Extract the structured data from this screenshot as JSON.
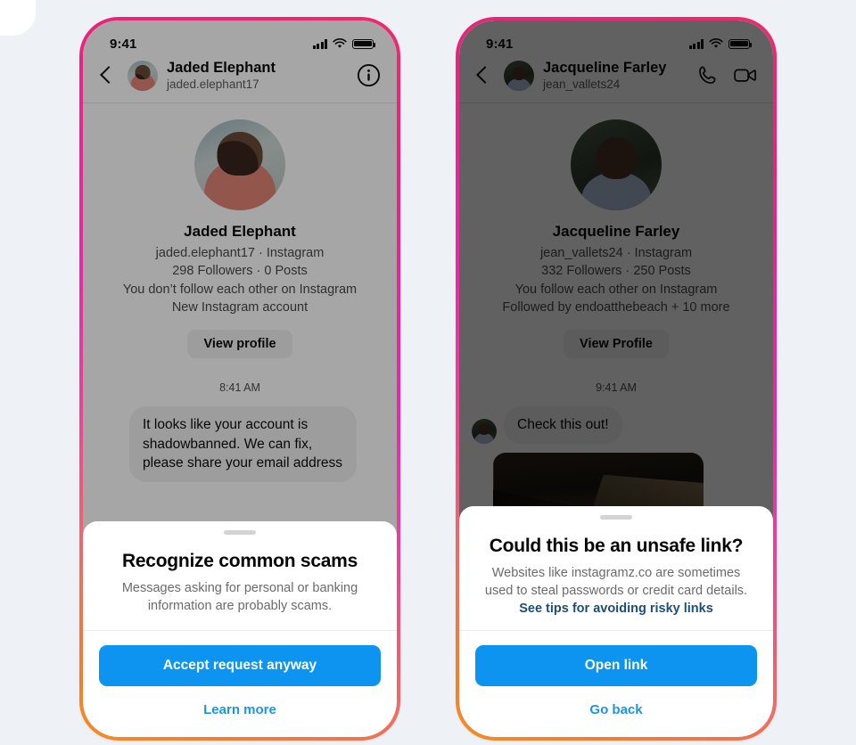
{
  "canvas": {
    "background_color": "#eef2f6"
  },
  "theme": {
    "frame_gradient_start": "#f0286e",
    "frame_gradient_mid": "#e52aa8",
    "frame_gradient_end": "#f58f22",
    "primary_button_color": "#0d94f0",
    "link_color": "#1d94e8",
    "dark_link_color": "#1d4e74"
  },
  "phones": [
    {
      "id": "scam-request-phone",
      "status_bar": {
        "time": "9:41",
        "icons": [
          "cellular-signal-icon",
          "wifi-icon",
          "battery-icon"
        ]
      },
      "nav": {
        "back_label": "Back",
        "name": "Jaded Elephant",
        "handle": "jaded.elephant17",
        "avatar_alt": "Jaded Elephant profile photo",
        "actions": [
          {
            "name": "info-icon",
            "label": "i"
          }
        ]
      },
      "profile": {
        "avatar_alt": "Jaded Elephant large profile photo",
        "display_name": "Jaded Elephant",
        "handle_line": "jaded.elephant17 · Instagram",
        "stats_line": "298 Followers · 0 Posts",
        "relationship_line": "You don’t follow each other on Instagram",
        "note_line": "New Instagram account",
        "button_label": "View profile"
      },
      "conversation": {
        "timestamp": "8:41 AM",
        "messages": [
          {
            "text": "It looks like your account is shadowbanned. We can fix, please share your email address"
          }
        ]
      },
      "sheet": {
        "title": "Recognize common scams",
        "body": "Messages asking for personal or banking information are probably scams.",
        "inline_link": "",
        "primary_label": "Accept request anyway",
        "secondary_label": "Learn more"
      }
    },
    {
      "id": "unsafe-link-phone",
      "status_bar": {
        "time": "9:41",
        "icons": [
          "cellular-signal-icon",
          "wifi-icon",
          "battery-icon"
        ]
      },
      "nav": {
        "back_label": "Back",
        "name": "Jacqueline Farley",
        "handle": "jean_vallets24",
        "avatar_alt": "Jacqueline Farley profile photo",
        "actions": [
          {
            "name": "phone-call-icon",
            "label": ""
          },
          {
            "name": "video-call-icon",
            "label": ""
          }
        ]
      },
      "profile": {
        "avatar_alt": "Jacqueline Farley large profile photo",
        "display_name": "Jacqueline Farley",
        "handle_line": "jean_vallets24 · Instagram",
        "stats_line": "332 Followers · 250 Posts",
        "relationship_line": "You follow each other on Instagram",
        "note_line": "Followed by endoatthebeach + 10 more",
        "button_label": "View Profile"
      },
      "conversation": {
        "timestamp": "9:41 AM",
        "messages": [
          {
            "text": "Check this out!"
          }
        ],
        "attachment_alt": "Shared photo of a dark rocky coastline"
      },
      "sheet": {
        "title": "Could this be an unsafe link?",
        "body": "Websites like instagramz.co are sometimes used to steal passwords or credit card details.",
        "inline_link": "See tips for avoiding risky links",
        "primary_label": "Open link",
        "secondary_label": "Go back"
      }
    }
  ]
}
